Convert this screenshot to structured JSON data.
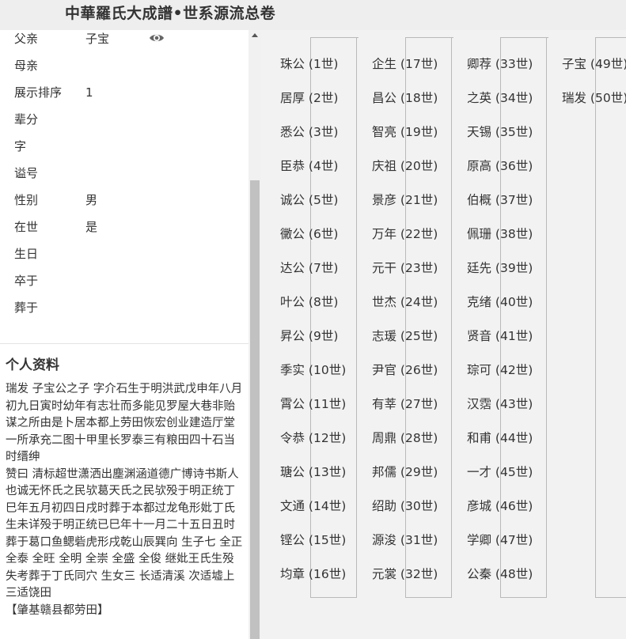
{
  "header": {
    "title": "中華羅氏大成譜•世系源流总卷"
  },
  "profile": {
    "fields": [
      {
        "label": "父亲",
        "value": "子宝"
      },
      {
        "label": "母亲",
        "value": ""
      },
      {
        "label": "展示排序",
        "value": "1"
      },
      {
        "label": "辈分",
        "value": ""
      },
      {
        "label": "字",
        "value": ""
      },
      {
        "label": "谥号",
        "value": ""
      },
      {
        "label": "性别",
        "value": "男"
      },
      {
        "label": "在世",
        "value": "是"
      },
      {
        "label": "生日",
        "value": ""
      },
      {
        "label": "卒于",
        "value": ""
      },
      {
        "label": "葬于",
        "value": ""
      }
    ]
  },
  "bio": {
    "title": "个人资料",
    "paragraphs": [
      "瑞发 子宝公之子 字介石生于明洪武戊申年八月初九日寅时幼年有志壮而多能见罗屋大巷非贻谋之所由是卜居本都上劳田恢宏创业建造厅堂一所承充二图十甲里长罗泰三有粮田四十石当时缙绅",
      "赞曰 清标超世潇洒出塵渊涵道德广博诗书斯人也诚无怀氏之民欤葛天氏之民欤殁于明正统丁巳年五月初四日戌时葬于本都过龙龟形妣丁氏生未详殁于明正统已巳年十一月二十五日丑时葬于葛口鱼鳃砦虎形戌乾山辰巽向 生子七 全正 全泰 全旺 全明 全崇 全盛 全俊 继妣王氏生殁失考葬于丁氏同穴 生女三 长适清溪 次适墟上 三适饶田",
      "【肇基赣县都劳田】"
    ]
  },
  "lineage": {
    "columns": [
      [
        "珠公 (1世)",
        "居厚 (2世)",
        "悉公 (3世)",
        "臣恭 (4世)",
        "诚公 (5世)",
        "黴公 (6世)",
        "达公 (7世)",
        "叶公 (8世)",
        "昇公 (9世)",
        "季实 (10世)",
        "霄公 (11世)",
        "令恭 (12世)",
        "瑭公 (13世)",
        "文通 (14世)",
        "铿公 (15世)",
        "均章 (16世)"
      ],
      [
        "企生 (17世)",
        "昌公 (18世)",
        "智亮 (19世)",
        "庆祖 (20世)",
        "景彦 (21世)",
        "万年 (22世)",
        "元干 (23世)",
        "世杰 (24世)",
        "志瑗 (25世)",
        "尹官 (26世)",
        "有莘 (27世)",
        "周鼎 (28世)",
        "邦儒 (29世)",
        "绍助 (30世)",
        "源浚 (31世)",
        "元裳 (32世)"
      ],
      [
        "卿荐 (33世)",
        "之英 (34世)",
        "天锡 (35世)",
        "原高 (36世)",
        "伯概 (37世)",
        "佩珊 (38世)",
        "廷先 (39世)",
        "克绪 (40世)",
        "贤音 (41世)",
        "琮可 (42世)",
        "汉霑 (43世)",
        "和甫 (44世)",
        "一才 (45世)",
        "彦城 (46世)",
        "学卿 (47世)",
        "公秦 (48世)"
      ],
      [
        "子宝 (49世)",
        "瑞发 (50世)"
      ]
    ]
  },
  "colors": {
    "header_bg": "#eeeeee",
    "panel_bg": "#f2f2f2",
    "line": "#b9b9b9"
  }
}
